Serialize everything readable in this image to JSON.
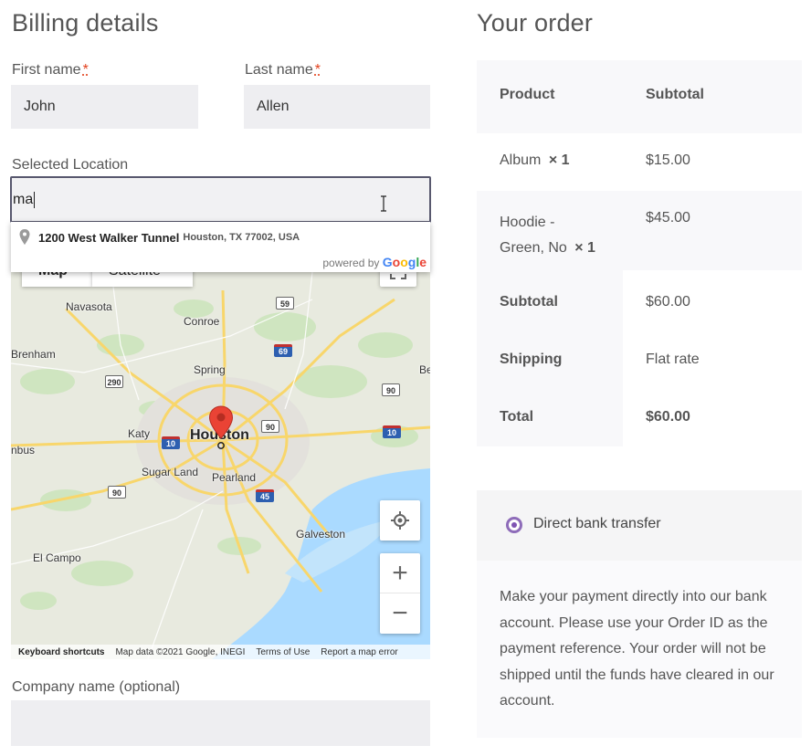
{
  "billing": {
    "title": "Billing details",
    "first_name_label": "First name",
    "first_name_value": "John",
    "last_name_label": "Last name",
    "last_name_value": "Allen",
    "required_mark": "*",
    "location_label": "Selected Location",
    "location_value": "ma",
    "company_label": "Company name (optional)",
    "company_value": ""
  },
  "autocomplete": {
    "main_text": "1200 West Walker Tunnel",
    "secondary_text": "Houston, TX 77002, USA",
    "powered_by": "powered by",
    "brand": "Google"
  },
  "map": {
    "map_type_map": "Map",
    "map_type_satellite": "Satellite",
    "labels": {
      "navasota": "Navasota",
      "conroe": "Conroe",
      "brenham": "Brenham",
      "spring": "Spring",
      "katy": "Katy",
      "houston": "Houston",
      "sugar_land": "Sugar Land",
      "pearland": "Pearland",
      "galveston": "Galveston",
      "el_campo": "El Campo",
      "bus": "nbus",
      "be": "Be"
    },
    "shields": {
      "s59": "59",
      "s69": "69",
      "s290": "290",
      "s90a": "90",
      "s90b": "90",
      "s10a": "10",
      "s10b": "10",
      "s45": "45",
      "s90c": "90"
    },
    "footer": {
      "keyboard": "Keyboard shortcuts",
      "data": "Map data ©2021 Google, INEGI",
      "terms": "Terms of Use",
      "report": "Report a map error"
    },
    "zoom_in": "+",
    "zoom_out": "−"
  },
  "order": {
    "title": "Your order",
    "col_product": "Product",
    "col_subtotal": "Subtotal",
    "items": [
      {
        "name": "Album",
        "qty": "× 1",
        "price": "$15.00"
      },
      {
        "name_line1": "Hoodie -",
        "name_line2": "Green, No",
        "qty": "× 1",
        "price": "$45.00"
      }
    ],
    "subtotal_label": "Subtotal",
    "subtotal_value": "$60.00",
    "shipping_label": "Shipping",
    "shipping_value": "Flat rate",
    "total_label": "Total",
    "total_value": "$60.00"
  },
  "payment": {
    "method_label": "Direct bank transfer",
    "description": "Make your payment directly into our bank account. Please use your Order ID as the payment reference. Your order will not be shipped until the funds have cleared in our account."
  },
  "icons": [
    "location-pin-icon",
    "map-marker-icon",
    "my-location-icon",
    "zoom-in-icon",
    "zoom-out-icon",
    "fullscreen-icon",
    "text-cursor-icon"
  ],
  "colors": {
    "input_bg": "#eeeef1",
    "accent_purple": "#7f54b3",
    "required_red": "#e2401c",
    "marker_red": "#ea4335",
    "water": "#aadaff",
    "highway": "#f8d66b"
  }
}
